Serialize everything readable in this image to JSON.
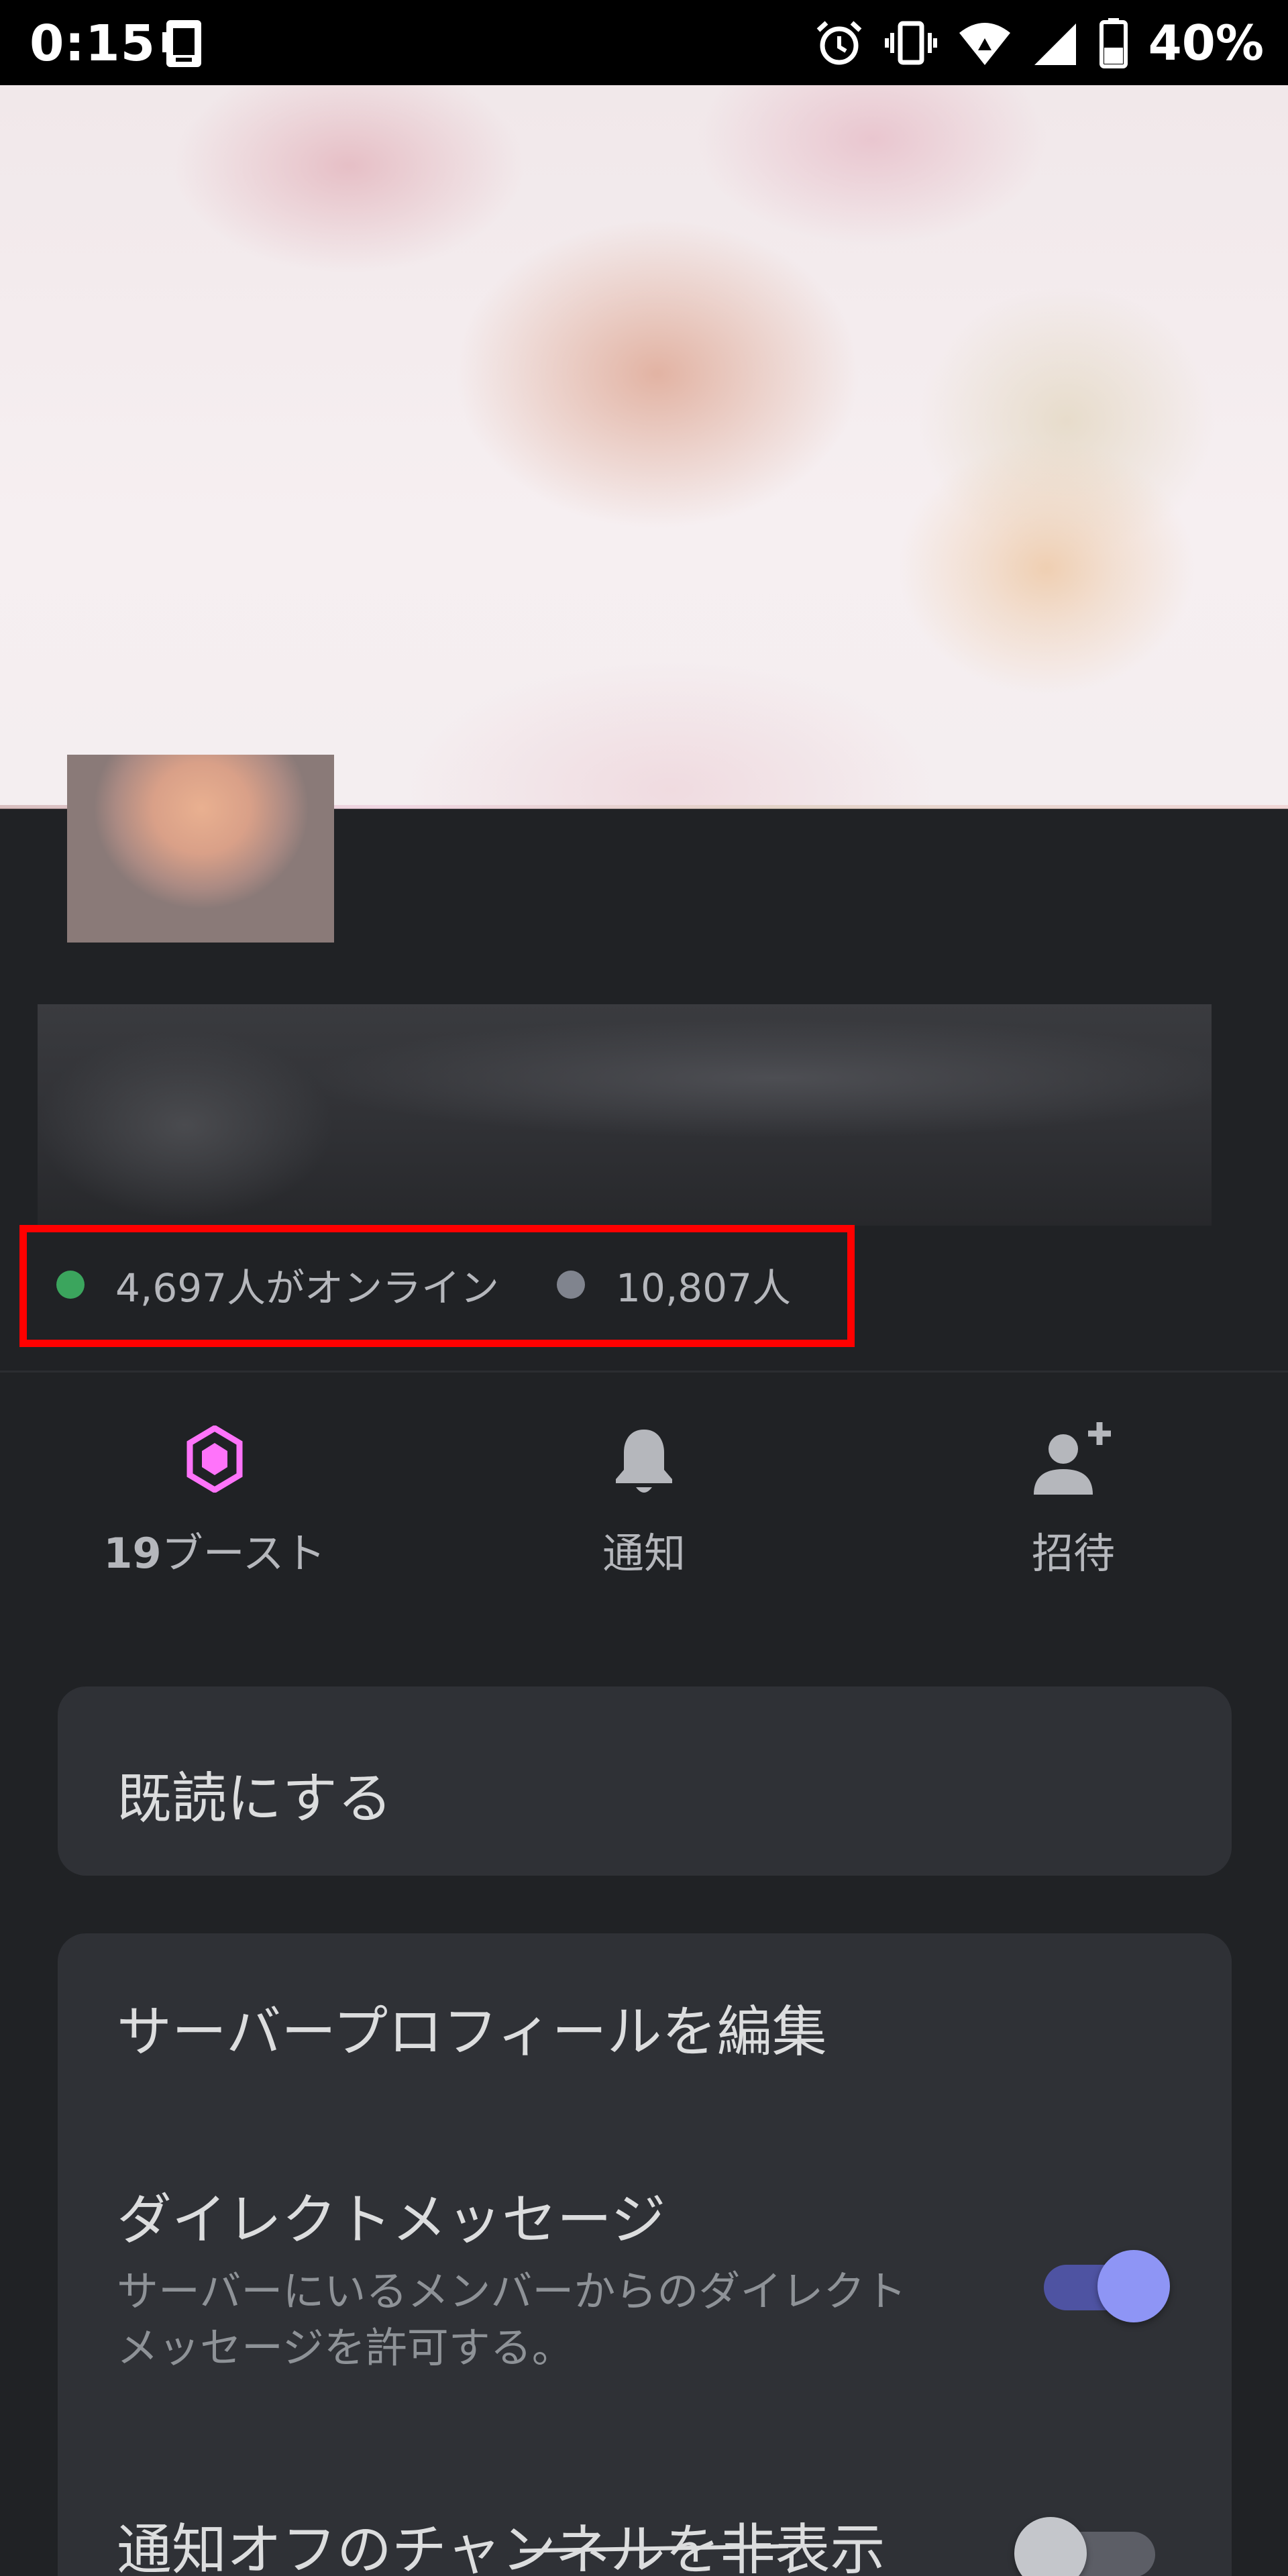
{
  "status_bar": {
    "time": "0:15",
    "battery": "40%",
    "icons": [
      "app-icon",
      "alarm-icon",
      "vibrate-icon",
      "wifi-icon",
      "signal-icon",
      "battery-icon"
    ]
  },
  "server": {
    "online_count": "4,697人がオンライン",
    "member_count": "10,807人",
    "online_color": "#3ba55d",
    "offline_color": "#80848e"
  },
  "actions": [
    {
      "icon": "boost-gem-icon",
      "count": "19",
      "label": "ブースト"
    },
    {
      "icon": "bell-icon",
      "label": "通知"
    },
    {
      "icon": "add-user-icon",
      "label": "招待"
    }
  ],
  "menu": {
    "mark_read": "既読にする",
    "edit_profile": "サーバープロフィールを編集",
    "direct_messages": {
      "title": "ダイレクトメッセージ",
      "desc_line1": "サーバーにいるメンバーからのダイレクト",
      "desc_line2": "メッセージを許可する。",
      "enabled": true
    },
    "hide_muted": {
      "title": "通知オフのチャンネルを非表示",
      "enabled": false
    }
  },
  "colors": {
    "background": "#202225",
    "card": "#2f3136",
    "accent": "#8e95f5",
    "highlight": "#ff0000",
    "boost": "#ff73fa"
  }
}
